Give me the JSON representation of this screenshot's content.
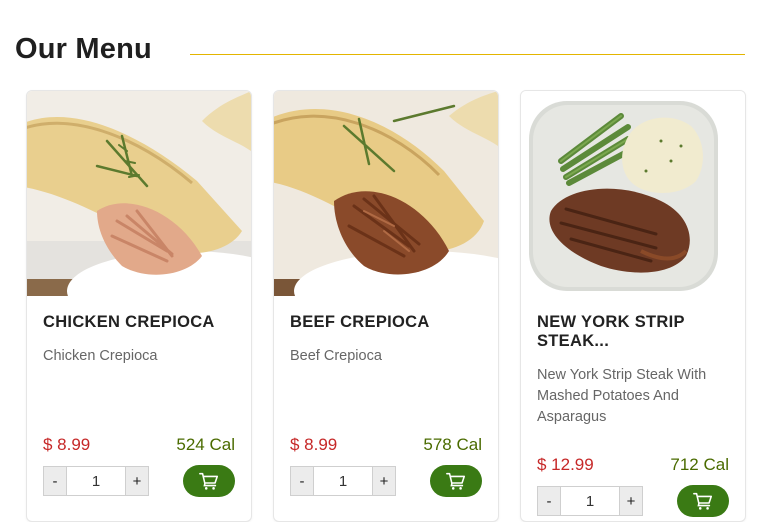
{
  "page": {
    "title": "Our Menu"
  },
  "colors": {
    "accent_line": "#e3b500",
    "price": "#c62828",
    "calories": "#4a6b00",
    "cart_button": "#3a7a14"
  },
  "cards": [
    {
      "name": "CHICKEN CREPIOCA",
      "description": "Chicken Crepioca",
      "price": "$ 8.99",
      "calories": "524 Cal",
      "quantity": "1",
      "minus_label": "-",
      "plus_label": "+",
      "image_icon": "chicken-crepioca-photo",
      "cart_icon": "shopping-cart-icon"
    },
    {
      "name": "BEEF CREPIOCA",
      "description": "Beef Crepioca",
      "price": "$ 8.99",
      "calories": "578 Cal",
      "quantity": "1",
      "minus_label": "-",
      "plus_label": "+",
      "image_icon": "beef-crepioca-photo",
      "cart_icon": "shopping-cart-icon"
    },
    {
      "name": "NEW YORK STRIP STEAK...",
      "description": "New York Strip Steak With Mashed Potatoes And Asparagus",
      "price": "$ 12.99",
      "calories": "712 Cal",
      "quantity": "1",
      "minus_label": "-",
      "plus_label": "+",
      "image_icon": "steak-plate-photo",
      "cart_icon": "shopping-cart-icon"
    }
  ]
}
